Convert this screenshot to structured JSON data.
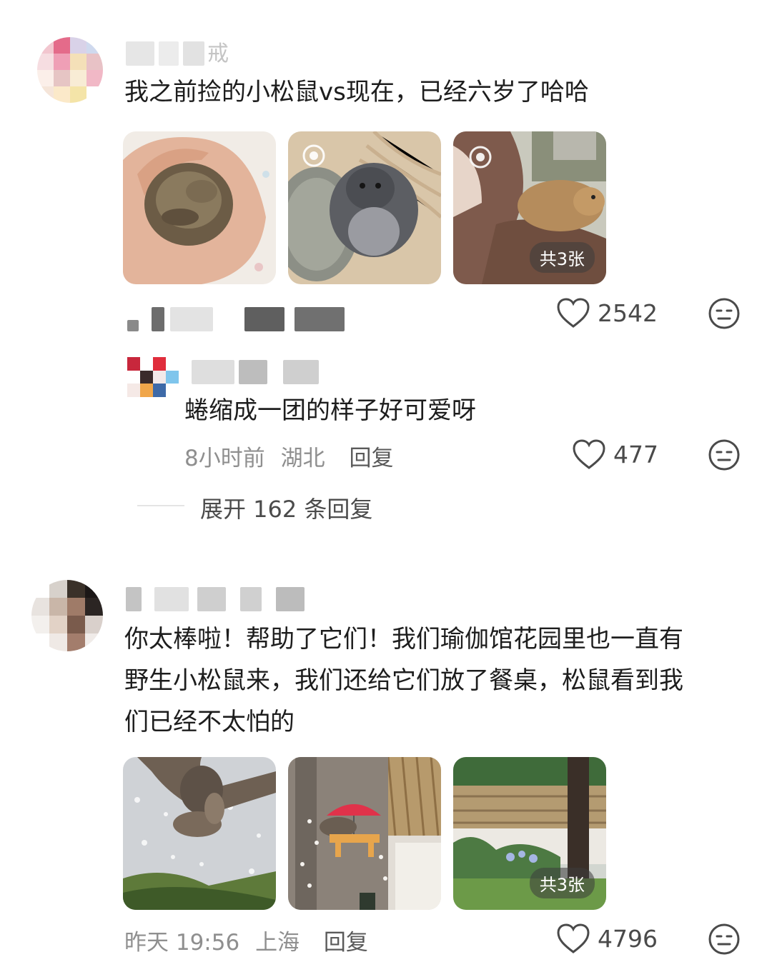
{
  "comments": [
    {
      "text": "我之前捡的小松鼠vs现在，已经六岁了哈哈",
      "name_fragment": "戒",
      "likes": "2542",
      "image_count_label": "共3张",
      "images": [
        "squirrel-baby-in-hand",
        "squirrel-grey-in-blanket",
        "squirrel-on-shoulder"
      ],
      "sub_reply": {
        "text": "蜷缩成一团的样子好可爱呀",
        "time": "8小时前",
        "location": "湖北",
        "reply_label": "回复",
        "likes": "477"
      },
      "expand_label": "展开 162 条回复"
    },
    {
      "text": "你太棒啦！帮助了它们！我们瑜伽馆花园里也一直有野生小松鼠来，我们还给它们放了餐桌，松鼠看到我们已经不太怕的",
      "line1": "你太棒啦！帮助了它们！我们瑜伽馆花园里也一直有",
      "line2": "野生小松鼠来，我们还给它们放了餐桌，松鼠看到我",
      "line3": "们已经不太怕的",
      "time": "昨天 19:56",
      "location": "上海",
      "reply_label": "回复",
      "likes": "4796",
      "image_count_label": "共3张",
      "images": [
        "squirrel-under-tree",
        "squirrel-feeder-umbrella",
        "garden-lawn"
      ]
    }
  ],
  "colors": {
    "text": "#1d1d1d",
    "meta": "#8f8f8f",
    "icon": "#4a4a4a"
  }
}
